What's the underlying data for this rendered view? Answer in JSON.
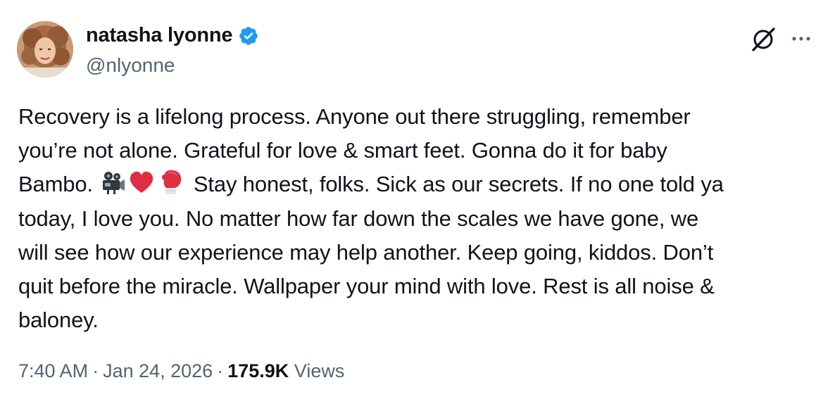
{
  "author": {
    "display_name": "natasha lyonne",
    "handle": "@nlyonne",
    "verified": true
  },
  "icons": {
    "avatar": "profile-photo",
    "verified": "verified-badge-icon",
    "grok": "grok-icon",
    "more": "more-options-icon",
    "emoji_1": "movie-camera-emoji",
    "emoji_2": "red-heart-emoji",
    "emoji_3": "boxing-glove-emoji"
  },
  "tweet": {
    "lines": [
      "Recovery is a lifelong process. Anyone out there struggling, remember",
      "you’re not alone. Grateful for love & smart feet. Gonna do it for baby",
      "Bambo. ",
      " Stay honest, folks. Sick as our secrets. If no one told ya",
      "today, I love you. No matter how far down the scales we have gone, we",
      "will see how our experience may help another. Keep going, kiddos. Don’t",
      "quit before the miracle. Wallpaper your mind with love. Rest is all noise &",
      "baloney."
    ]
  },
  "meta": {
    "time": "7:40 AM",
    "separator": "·",
    "date": "Jan 24, 2026",
    "views_count": "175.9K",
    "views_label": "Views"
  },
  "colors": {
    "text_primary": "#0f1419",
    "text_secondary": "#536471",
    "verified_blue": "#1d9bf0"
  }
}
